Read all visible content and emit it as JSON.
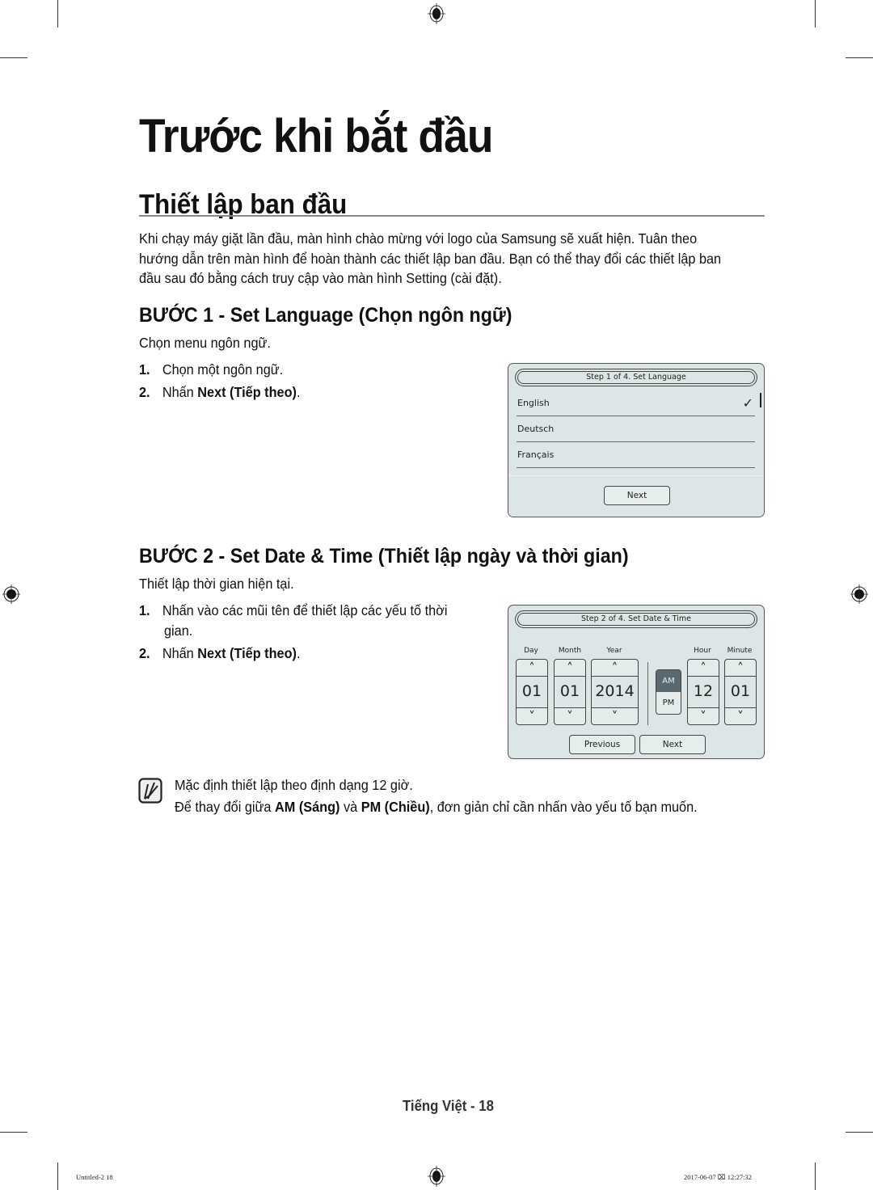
{
  "page": {
    "title": "Trước khi bắt đầu",
    "section_title": "Thiết lập ban đầu",
    "intro": "Khi chạy máy giặt lần đầu, màn hình chào mừng với logo của Samsung sẽ xuất hiện. Tuân theo hướng dẫn trên màn hình để hoàn thành các thiết lập ban đầu. Bạn có thể thay đổi các thiết lập ban đầu sau đó bằng cách truy cập vào màn hình Setting (cài đặt)."
  },
  "step1": {
    "heading": "BƯỚC 1 - Set Language (Chọn ngôn ngữ)",
    "subtext": "Chọn menu ngôn ngữ.",
    "items": [
      {
        "num": "1.",
        "text": "Chọn một ngôn ngữ.",
        "bold": ""
      },
      {
        "num": "2.",
        "text": "Nhấn ",
        "bold": "Next (Tiếp theo)",
        "after": "."
      }
    ],
    "screen": {
      "title": "Step 1 of 4. Set Language",
      "languages": [
        {
          "label": "English",
          "selected": true
        },
        {
          "label": "Deutsch",
          "selected": false
        },
        {
          "label": "Français",
          "selected": false
        }
      ],
      "check_icon": "✓",
      "next_label": "Next"
    }
  },
  "step2": {
    "heading": "BƯỚC 2 - Set Date & Time (Thiết lập ngày và thời gian)",
    "subtext": "Thiết lập thời gian hiện tại.",
    "items": [
      {
        "num": "1.",
        "text": "Nhấn vào các mũi tên để thiết lập các yếu tố thời",
        "text2": "gian."
      },
      {
        "num": "2.",
        "text": "Nhấn ",
        "bold": "Next (Tiếp theo)",
        "after": "."
      }
    ],
    "screen": {
      "title": "Step 2 of 4. Set Date & Time",
      "columns": [
        {
          "label": "Day",
          "value": "01"
        },
        {
          "label": "Month",
          "value": "01"
        },
        {
          "label": "Year",
          "value": "2014"
        },
        {
          "label": "Hour",
          "value": "12"
        },
        {
          "label": "Minute",
          "value": "01"
        }
      ],
      "am_label": "AM",
      "pm_label": "PM",
      "selected_period": "AM",
      "previous_label": "Previous",
      "next_label": "Next",
      "up_icon": "^",
      "down_icon": "v"
    }
  },
  "note": {
    "line1": "Mặc định thiết lập theo định dạng 12 giờ.",
    "line2_pre": "Để thay đổi giữa ",
    "line2_b1": "AM (Sáng)",
    "line2_mid": " và ",
    "line2_b2": "PM (Chiều)",
    "line2_post": ", đơn giản chỉ cần nhấn vào yếu tố bạn muốn."
  },
  "footer": {
    "page_label": "Tiếng Việt - 18",
    "slug_left": "Untitled-2   18",
    "slug_right": "2017-06-07   ⌧ 12:27:32"
  }
}
